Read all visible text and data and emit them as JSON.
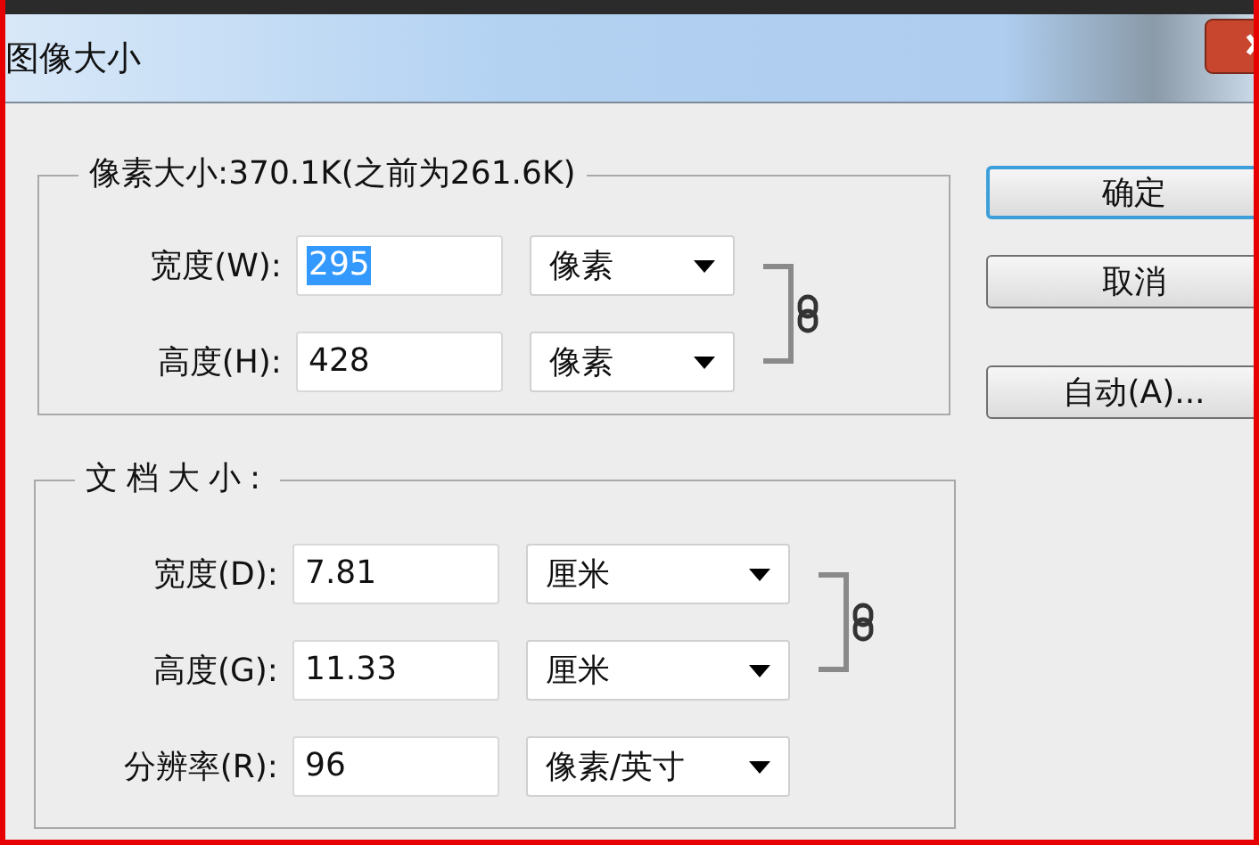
{
  "window": {
    "title": "图像大小"
  },
  "groups": [
    {
      "legend": "像素大小:370.1K(之前为261.6K)",
      "kind": "pixels",
      "constrained": true,
      "rows": [
        {
          "label": "宽度(W):",
          "value": "295",
          "text_selected": true,
          "unit": "像素"
        },
        {
          "label": "高度(H):",
          "value": "428",
          "text_selected": false,
          "unit": "像素"
        }
      ]
    },
    {
      "legend": "文档大小:",
      "kind": "document",
      "constrained": true,
      "rows": [
        {
          "label": "宽度(D):",
          "value": "7.81",
          "text_selected": false,
          "unit": "厘米"
        },
        {
          "label": "高度(G):",
          "value": "11.33",
          "text_selected": false,
          "unit": "厘米"
        },
        {
          "label": "分辨率(R):",
          "value": "96",
          "text_selected": false,
          "unit": "像素/英寸"
        }
      ]
    }
  ],
  "buttons": [
    {
      "label": "确定",
      "default": true
    },
    {
      "label": "取消",
      "default": false
    },
    {
      "label": "自动(A)...",
      "default": false
    }
  ]
}
